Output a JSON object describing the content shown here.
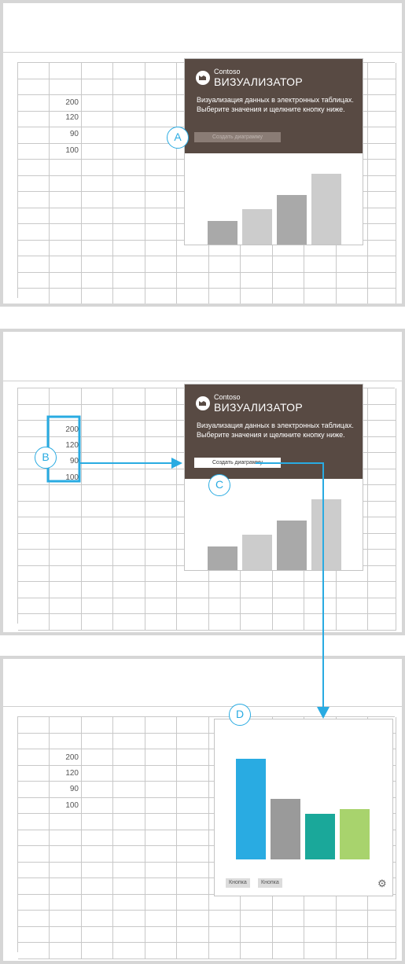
{
  "sheet_values": [
    "200",
    "120",
    "90",
    "100"
  ],
  "taskpane": {
    "brand_small": "Contoso",
    "brand_title": "ВИЗУАЛИЗАТОР",
    "description": "Визуализация данных в электронных таблицах. Выберите значения и щелкните кнопку ниже.",
    "create_chart_button": "Создать диаграмму",
    "sample_chart_values": [
      200,
      300,
      420,
      600
    ],
    "colors": {
      "header": "#584a43",
      "bar_light": "#cccccc",
      "bar_dark": "#a9a9a9"
    }
  },
  "panel1": {
    "callout_a": "A",
    "button_state": "disabled"
  },
  "panel2": {
    "callout_b": "B",
    "callout_c": "C",
    "button_state": "enabled"
  },
  "panel3": {
    "callout_d": "D",
    "chart_data": {
      "type": "bar",
      "values": [
        200,
        120,
        90,
        100
      ],
      "colors": [
        "#29abe2",
        "#9a9a9a",
        "#1aa89a",
        "#a8d36d"
      ]
    },
    "button1": "Кнопка",
    "button2": "Кнопка",
    "settings_icon": "gear-icon"
  },
  "accent_color": "#29abe2"
}
